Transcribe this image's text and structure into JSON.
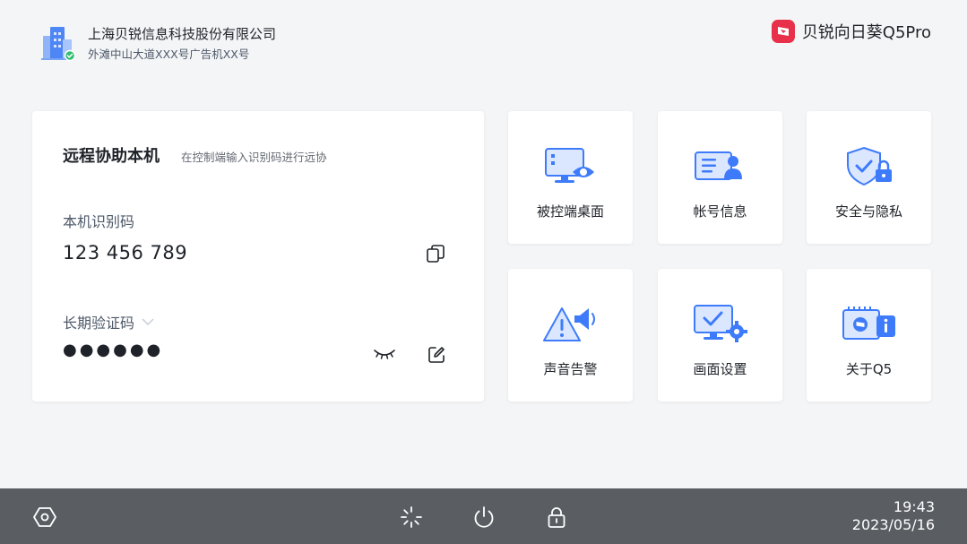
{
  "header": {
    "company_name": "上海贝锐信息科技股份有限公司",
    "company_address": "外滩中山大道XXX号广告机XX号",
    "brand_name": "贝锐向日葵Q5Pro"
  },
  "remote": {
    "title": "远程协助本机",
    "subtitle": "在控制端输入识别码进行远协",
    "id_label": "本机识别码",
    "id_value": "123 456 789",
    "password_label": "长期验证码",
    "password_value": "●●●●●●"
  },
  "tiles": [
    {
      "label": "被控端桌面",
      "icon": "monitor-eye-icon"
    },
    {
      "label": "帐号信息",
      "icon": "account-card-icon"
    },
    {
      "label": "安全与隐私",
      "icon": "shield-lock-icon"
    },
    {
      "label": "声音告警",
      "icon": "alarm-speaker-icon"
    },
    {
      "label": "画面设置",
      "icon": "display-settings-icon"
    },
    {
      "label": "关于Q5",
      "icon": "about-info-icon"
    }
  ],
  "taskbar": {
    "icons": [
      "settings-hexagon-icon",
      "loading-icon",
      "power-icon",
      "lock-icon"
    ],
    "time": "19:43",
    "date": "2023/05/16"
  },
  "colors": {
    "accent_blue": "#3e7bfa",
    "brand_red": "#e8304a",
    "taskbar_bg": "#5a5e63",
    "background": "#f4f5f7"
  }
}
